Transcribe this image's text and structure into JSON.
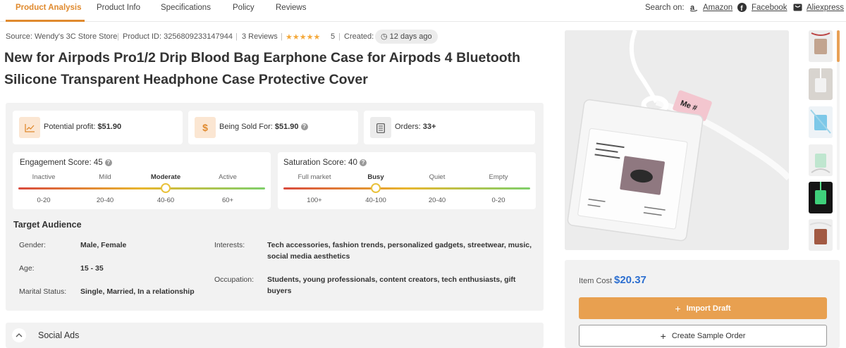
{
  "tabs": [
    {
      "label": "Product Analysis",
      "active": true
    },
    {
      "label": "Product Info"
    },
    {
      "label": "Specifications"
    },
    {
      "label": "Policy"
    },
    {
      "label": "Reviews"
    }
  ],
  "search": {
    "label": "Search on:",
    "links": [
      {
        "label": "Amazon",
        "icon": "amazon-icon"
      },
      {
        "label": "Facebook",
        "icon": "facebook-icon"
      },
      {
        "label": "Aliexpress",
        "icon": "aliexpress-icon"
      }
    ]
  },
  "meta": {
    "source": "Source: Wendy's 3C Store Store",
    "product_id": "Product ID: 3256809233147944",
    "reviews": "3 Reviews",
    "stars": "★★★★★",
    "rating": "5",
    "created_label": "Created:",
    "created_value": "12 days ago"
  },
  "title": "New for Airpods Pro1/2 Drip Blood Bag Earphone Case for Airpods 4 Bluetooth Silicone Transparent Headphone Case Protective Cover",
  "stats": {
    "profit_label": "Potential profit:",
    "profit_value": "$51.90",
    "sold_label": "Being Sold For:",
    "sold_value": "$51.90",
    "orders_label": "Orders:",
    "orders_value": "33+"
  },
  "engagement": {
    "title": "Engagement Score: 45",
    "levels": [
      "Inactive",
      "Mild",
      "Moderate",
      "Active"
    ],
    "active_level": 2,
    "ranges": [
      "0-20",
      "20-40",
      "40-60",
      "60+"
    ]
  },
  "saturation": {
    "title": "Saturation Score: 40",
    "levels": [
      "Full market",
      "Busy",
      "Quiet",
      "Empty"
    ],
    "active_level": 1,
    "ranges": [
      "100+",
      "40-100",
      "20-40",
      "0-20"
    ]
  },
  "audience": {
    "heading": "Target Audience",
    "gender_label": "Gender:",
    "gender": "Male, Female",
    "age_label": "Age:",
    "age": "15 - 35",
    "marital_label": "Marital Status:",
    "marital": "Single, Married, In a relationship",
    "interests_label": "Interests:",
    "interests": "Tech accessories, fashion trends, personalized gadgets, streetwear, music, social media aesthetics",
    "occupation_label": "Occupation:",
    "occupation": "Students, young professionals, content creators, tech enthusiasts, gift buyers"
  },
  "ads": {
    "label": "Social Ads"
  },
  "purchase": {
    "cost_label": "Item Cost",
    "cost_value": "$20.37",
    "import_label": "Import Draft",
    "sample_label": "Create Sample Order"
  },
  "colors": {
    "accent": "#e08a2e",
    "price": "#2d6fd0",
    "button": "#e8a050"
  }
}
